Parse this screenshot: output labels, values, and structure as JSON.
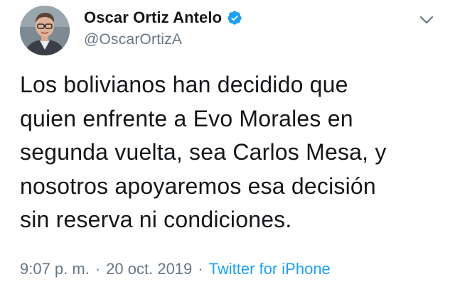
{
  "tweet": {
    "author": {
      "display_name": "Oscar Ortiz Antelo",
      "handle": "@OscarOrtizA",
      "verified": true,
      "avatar": "profile-photo"
    },
    "text": "Los bolivianos han decidido que\nquien enfrente a Evo Morales en\nsegunda vuelta, sea Carlos Mesa, y\nnosotros apoyaremos esa decisión\nsin reserva ni condiciones.",
    "time": "9:07 p. m.",
    "separator": "·",
    "date": "20 oct. 2019",
    "source": "Twitter for iPhone",
    "menu_icon": "chevron-down-icon"
  },
  "colors": {
    "text": "#14171a",
    "secondary": "#657786",
    "accent": "#1da1f2",
    "background": "#ffffff"
  }
}
